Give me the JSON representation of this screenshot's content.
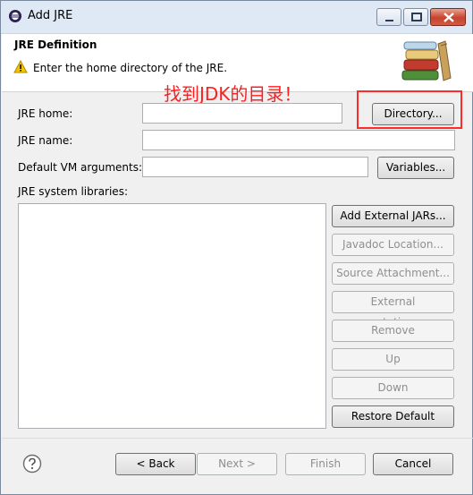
{
  "window": {
    "title": "Add JRE"
  },
  "header": {
    "title": "JRE Definition",
    "message": "Enter the home directory of the JRE."
  },
  "annotation": {
    "text": "找到JDK的目录！",
    "color": "#ff1e1e"
  },
  "form": {
    "jre_home": {
      "label": "JRE home:",
      "value": ""
    },
    "directory_button": "Directory...",
    "jre_name": {
      "label": "JRE name:",
      "value": ""
    },
    "vm_args": {
      "label": "Default VM arguments:",
      "value": ""
    },
    "variables_button": "Variables...",
    "libraries_label": "JRE system libraries:"
  },
  "library_buttons": [
    {
      "label": "Add External JARs...",
      "enabled": true
    },
    {
      "label": "Javadoc Location...",
      "enabled": false
    },
    {
      "label": "Source Attachment...",
      "enabled": false
    },
    {
      "label": "External annotations...",
      "enabled": false
    },
    {
      "label": "Remove",
      "enabled": false
    },
    {
      "label": "Up",
      "enabled": false
    },
    {
      "label": "Down",
      "enabled": false
    },
    {
      "label": "Restore Default",
      "enabled": true
    }
  ],
  "footer": {
    "back": "< Back",
    "next": "Next >",
    "finish": "Finish",
    "cancel": "Cancel"
  },
  "icons": [
    "app-icon",
    "minimize-icon",
    "maximize-icon",
    "close-icon",
    "warning-icon",
    "books-icon",
    "help-icon"
  ]
}
